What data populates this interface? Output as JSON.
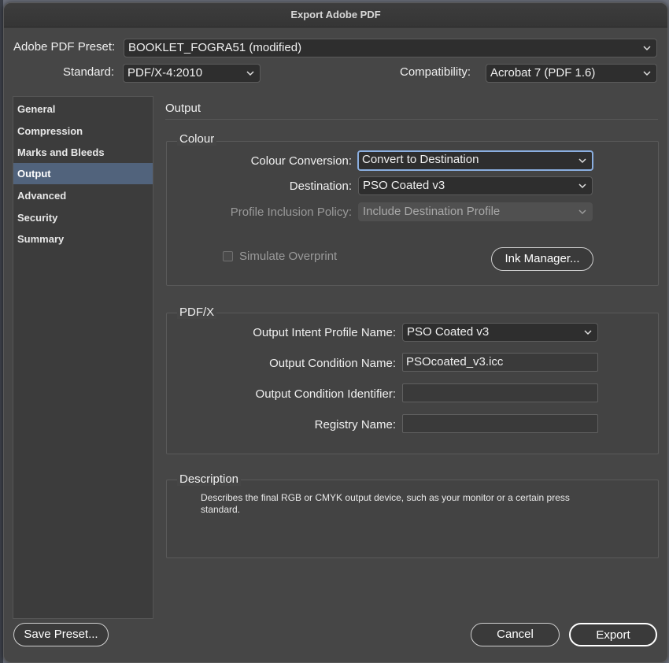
{
  "window": {
    "title": "Export Adobe PDF"
  },
  "preset": {
    "label": "Adobe PDF Preset:",
    "value": "BOOKLET_FOGRA51 (modified)"
  },
  "standard": {
    "label": "Standard:",
    "value": "PDF/X-4:2010"
  },
  "compatibility": {
    "label": "Compatibility:",
    "value": "Acrobat 7 (PDF 1.6)"
  },
  "sidebar": {
    "items": [
      {
        "label": "General"
      },
      {
        "label": "Compression"
      },
      {
        "label": "Marks and Bleeds"
      },
      {
        "label": "Output"
      },
      {
        "label": "Advanced"
      },
      {
        "label": "Security"
      },
      {
        "label": "Summary"
      }
    ],
    "active": "Output"
  },
  "panel": {
    "title": "Output"
  },
  "colour": {
    "title": "Colour",
    "conversion_label": "Colour Conversion:",
    "conversion_value": "Convert to Destination",
    "destination_label": "Destination:",
    "destination_value": "PSO Coated v3",
    "profile_label": "Profile Inclusion Policy:",
    "profile_value": "Include Destination Profile",
    "simulate_label": "Simulate Overprint",
    "ink_manager_label": "Ink Manager..."
  },
  "pdfx": {
    "title": "PDF/X",
    "intent_label": "Output Intent Profile Name:",
    "intent_value": "PSO Coated v3",
    "condition_name_label": "Output Condition Name:",
    "condition_name_value": "PSOcoated_v3.icc",
    "condition_id_label": "Output Condition Identifier:",
    "condition_id_value": "",
    "registry_label": "Registry Name:",
    "registry_value": ""
  },
  "description": {
    "title": "Description",
    "text_line1": "Describes the final RGB or CMYK output device, such as your monitor or a certain press",
    "text_line2": "standard."
  },
  "footer": {
    "save_preset_label": "Save Preset...",
    "cancel_label": "Cancel",
    "export_label": "Export"
  },
  "icons": {
    "dropdown": "chevron-down-icon"
  },
  "colors": {
    "selection": "#51637c",
    "focus_ring": "#8aaee0"
  }
}
